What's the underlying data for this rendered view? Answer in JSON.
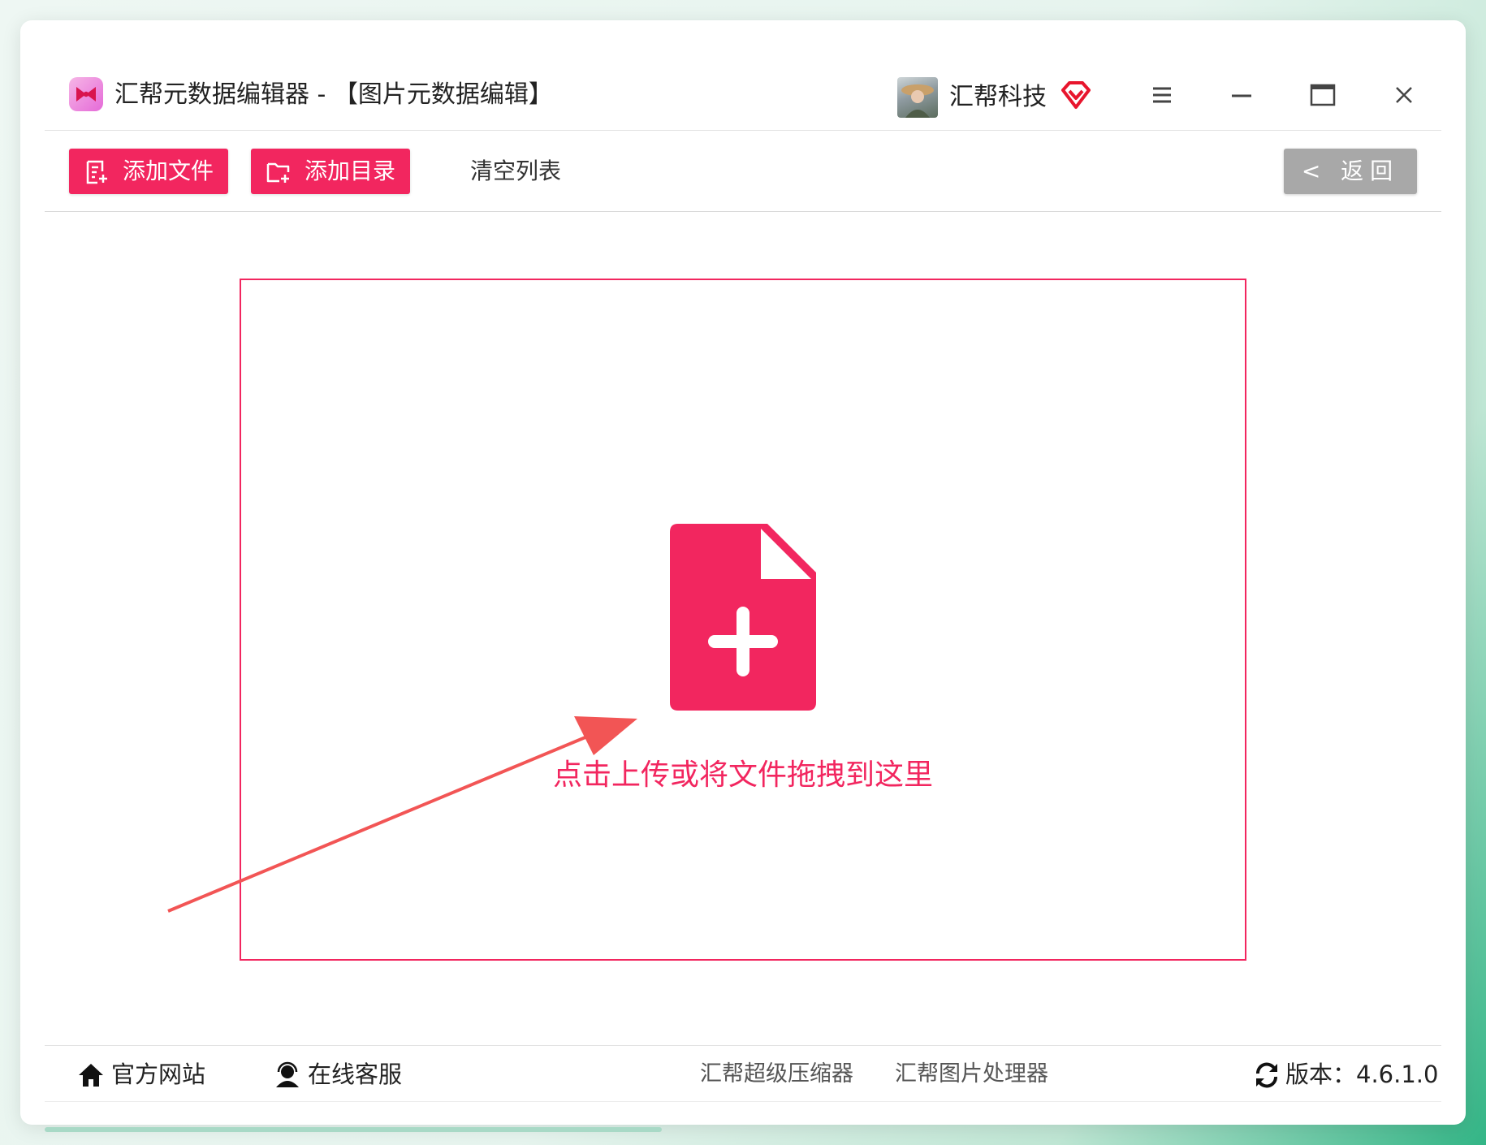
{
  "titlebar": {
    "app_title": "汇帮元数据编辑器 - 【图片元数据编辑】",
    "username": "汇帮科技"
  },
  "toolbar": {
    "add_file": "添加文件",
    "add_folder": "添加目录",
    "clear_list": "清空列表",
    "back": "< 返回"
  },
  "dropzone": {
    "hint": "点击上传或将文件拖拽到这里"
  },
  "footer": {
    "website": "官方网站",
    "support": "在线客服",
    "link_compressor": "汇帮超级压缩器",
    "link_image_tool": "汇帮图片处理器",
    "version": "版本：4.6.1.0"
  },
  "colors": {
    "accent": "#f2265f",
    "back_button": "#a8a8a8",
    "annotation_arrow": "#f25555"
  }
}
